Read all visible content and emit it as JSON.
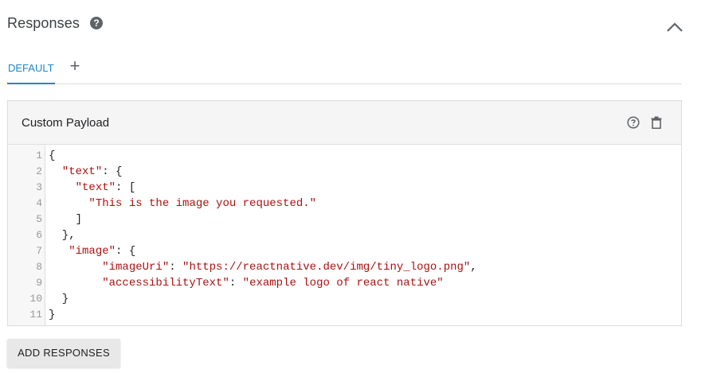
{
  "header": {
    "title": "Responses",
    "help_glyph": "?"
  },
  "tabs": {
    "default_label": "DEFAULT",
    "add_glyph": "+"
  },
  "card": {
    "title": "Custom Payload"
  },
  "code": {
    "lines": [
      {
        "n": "1",
        "text": "{"
      },
      {
        "n": "2",
        "text": "  \"text\": {"
      },
      {
        "n": "3",
        "text": "    \"text\": ["
      },
      {
        "n": "4",
        "text": "      \"This is the image you requested.\""
      },
      {
        "n": "5",
        "text": "    ]"
      },
      {
        "n": "6",
        "text": "  },"
      },
      {
        "n": "7",
        "text": "   \"image\": {"
      },
      {
        "n": "8",
        "text": "        \"imageUri\": \"https://reactnative.dev/img/tiny_logo.png\","
      },
      {
        "n": "9",
        "text": "        \"accessibilityText\": \"example logo of react native\""
      },
      {
        "n": "10",
        "text": "  }"
      },
      {
        "n": "11",
        "text": "}"
      }
    ]
  },
  "actions": {
    "add_responses_label": "ADD RESPONSES"
  },
  "colors": {
    "accent": "#1e88c7",
    "string": "#aa1111"
  },
  "icons": {
    "header_help": "help-icon",
    "collapse": "chevron-up-icon",
    "card_help": "help-outline-icon",
    "delete": "trash-icon"
  }
}
